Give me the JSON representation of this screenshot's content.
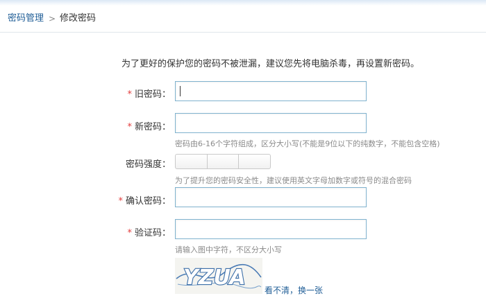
{
  "breadcrumb": {
    "root": "密码管理",
    "separator": ">",
    "current": "修改密码"
  },
  "notice": "为了更好的保护您的密码不被泄漏，建议您先将电脑杀毒，再设置新密码。",
  "required_mark": "*",
  "form": {
    "old_password": {
      "label": "旧密码：",
      "value": ""
    },
    "new_password": {
      "label": "新密码：",
      "value": "",
      "hint": "密码由6-16个字符组成，区分大小写(不能是9位以下的纯数字，不能包含空格)"
    },
    "strength": {
      "label": "密码强度：",
      "level": 0,
      "segments": 3,
      "hint": "为了提升您的密码安全性，建议使用英文字母加数字或符号的混合密码"
    },
    "confirm_password": {
      "label": "确认密码：",
      "value": ""
    },
    "captcha": {
      "label": "验证码：",
      "value": "",
      "hint": "请输入图中字符，不区分大小写",
      "image_text": "YZUA",
      "refresh_label": "看不清，换一张"
    }
  },
  "colors": {
    "link": "#1f5d96",
    "required": "#e23c3c",
    "input_border": "#7fb2ce",
    "captcha_text": "#3b6ea8"
  }
}
